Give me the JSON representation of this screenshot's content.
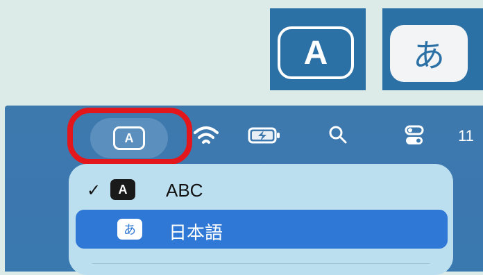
{
  "tiles": {
    "roman_glyph": "A",
    "kana_glyph": "あ"
  },
  "menubar": {
    "input_source_glyph": "A",
    "clock_text": "11"
  },
  "input_menu": {
    "items": [
      {
        "badge": "A",
        "label": "ABC",
        "checked": true,
        "check_glyph": "✓"
      },
      {
        "badge": "あ",
        "label": "日本語",
        "checked": false
      }
    ]
  },
  "colors": {
    "tile_blue": "#2c71a6",
    "highlight_red": "#e3171b",
    "selection_blue": "#2f78d6",
    "menu_bg": "#bcdff0"
  },
  "icons": [
    "input-source-icon",
    "wifi-icon",
    "battery-charging-icon",
    "search-icon",
    "control-center-icon",
    "checkmark-icon"
  ]
}
